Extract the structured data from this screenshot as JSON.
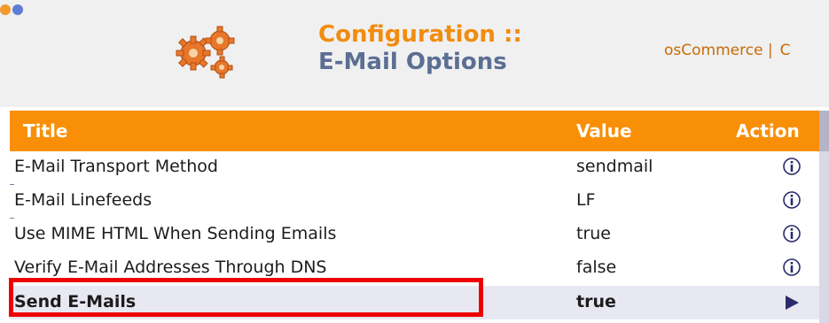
{
  "header": {
    "title_line1": "Configuration ::",
    "title_line2": "E-Mail Options",
    "links": {
      "oscommerce": "osCommerce |",
      "next_partial": "C"
    }
  },
  "table": {
    "columns": {
      "title": "Title",
      "value": "Value",
      "action": "Action"
    },
    "rows": [
      {
        "title": "E-Mail Transport Method",
        "value": "sendmail",
        "action_icon": "info-icon"
      },
      {
        "title": "E-Mail Linefeeds",
        "value": "LF",
        "action_icon": "info-icon"
      },
      {
        "title": "Use MIME HTML When Sending Emails",
        "value": "true",
        "action_icon": "info-icon"
      },
      {
        "title": "Verify E-Mail Addresses Through DNS",
        "value": "false",
        "action_icon": "info-icon"
      },
      {
        "title": "Send E-Mails",
        "value": "true",
        "action_icon": "arrow-right-icon",
        "selected": true
      }
    ]
  },
  "colors": {
    "accent_orange": "#f88f07",
    "title_orange": "#f28c0f",
    "title_blue": "#5b6e93",
    "selection_bg": "#e8e8f2",
    "highlight_red": "#ee0000",
    "icon_navy": "#2b2b6b"
  }
}
